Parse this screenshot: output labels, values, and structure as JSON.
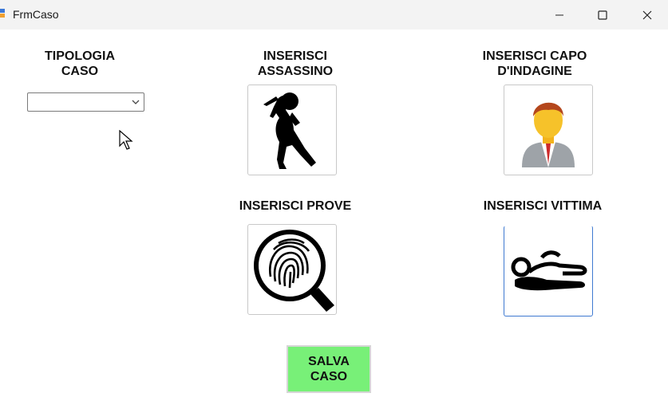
{
  "window": {
    "title": "FrmCaso"
  },
  "labels": {
    "tipologia": "TIPOLOGIA\nCASO",
    "assassino": "INSERISCI\nASSASSINO",
    "capo": "INSERISCI CAPO\nD'INDAGINE",
    "prove": "INSERISCI PROVE",
    "vittima": "INSERISCI VITTIMA"
  },
  "combo": {
    "value": ""
  },
  "buttons": {
    "save_label": "SALVA\nCASO"
  },
  "icons": {
    "assassino": "knife-attacker-icon",
    "capo": "businessman-icon",
    "prove": "fingerprint-magnifier-icon",
    "vittima": "body-outline-icon"
  },
  "colors": {
    "save_bg": "#78f078",
    "focus_border": "#3f7ad1"
  }
}
